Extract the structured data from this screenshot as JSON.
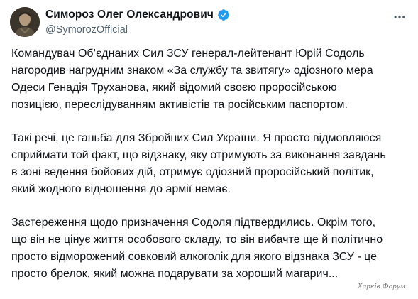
{
  "author": {
    "display_name": "Симороз Олег Олександрович",
    "handle": "@SymorozOfficial",
    "verified_icon": "verified-badge-icon",
    "avatar_icon": "avatar-photo"
  },
  "more_icon": "more-dots-icon",
  "colors": {
    "verified": "#1d9bf0",
    "text": "#0f1419",
    "secondary": "#536471"
  },
  "paragraphs": [
    {
      "lines": [
        "Командувач Об’єднаних Сил ЗСУ генерал-лейтенант Юрій Содоль",
        "нагородив нагрудним знаком «За службу та звитягу» одіозного мера",
        "Одеси Генадія Труханова, який відомий своєю проросійською",
        "позицією, переслідуванням активістів та російським паспортом."
      ]
    },
    {
      "lines": [
        "Такі речі, це ганьба для Збройних Сил України. Я просто відмовляюся",
        "сприймати той факт, що відзнаку, яку отримують за виконання завдань",
        "в зоні ведення бойових дій, отримує одіозний проросійський політик,",
        "який жодного відношення до армії немає."
      ]
    },
    {
      "lines": [
        "Застереження щодо призначення Содоля підтвердились. Окрім того,",
        "що він не цінує життя особового складу, то він вибачте ще й політично",
        "просто відморожений совковий алкоголік для якого відзнака ЗСУ - це",
        "просто брелок, який можна подарувати за хороший магарич..."
      ]
    }
  ],
  "watermark": "Харків Форум"
}
